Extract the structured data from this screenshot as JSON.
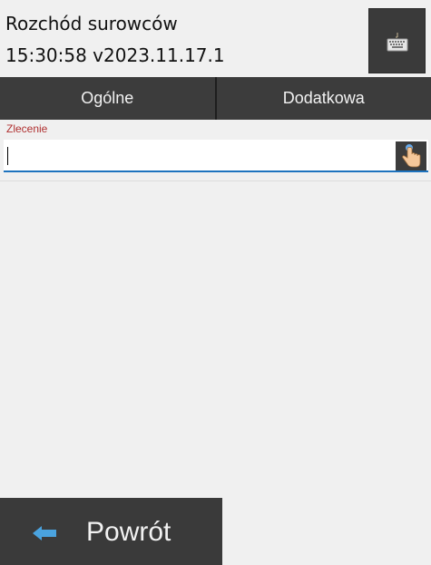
{
  "header": {
    "title": "Rozchód surowców",
    "subtitle": "15:30:58   v2023.11.17.1",
    "keyboard_icon": "keyboard-icon"
  },
  "tabs": [
    {
      "label": "Ogólne"
    },
    {
      "label": "Dodatkowa"
    }
  ],
  "form": {
    "field_label": "Zlecenie",
    "field_value": "",
    "touch_icon": "hand-pointer-icon"
  },
  "footer": {
    "back_label": "Powrót",
    "back_icon": "arrow-left-icon"
  },
  "colors": {
    "dark_button": "#3a3a3a",
    "background": "#f0f0f0",
    "label_red": "#b03030",
    "input_underline": "#1e73be",
    "arrow_blue": "#4aa3df"
  }
}
